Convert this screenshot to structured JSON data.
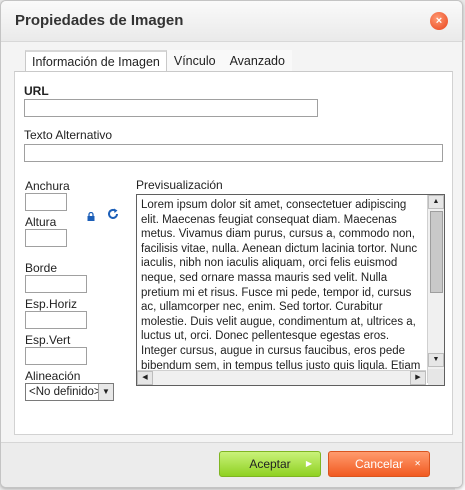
{
  "dialog": {
    "title": "Propiedades de Imagen",
    "close_glyph": "×"
  },
  "tabs": [
    {
      "label": "Información de Imagen",
      "active": true
    },
    {
      "label": "Vínculo",
      "active": false
    },
    {
      "label": "Avanzado",
      "active": false
    }
  ],
  "form": {
    "url_label": "URL",
    "url_value": "",
    "alt_label": "Texto Alternativo",
    "alt_value": "",
    "width_label": "Anchura",
    "width_value": "",
    "height_label": "Altura",
    "height_value": "",
    "border_label": "Borde",
    "border_value": "",
    "hspace_label": "Esp.Horiz",
    "hspace_value": "",
    "vspace_label": "Esp.Vert",
    "vspace_value": "",
    "align_label": "Alineación",
    "align_selected": "<No definido>"
  },
  "preview": {
    "label": "Previsualización",
    "text": "Lorem ipsum dolor sit amet, consectetuer adipiscing elit. Maecenas feugiat consequat diam. Maecenas metus. Vivamus diam purus, cursus a, commodo non, facilisis vitae, nulla. Aenean dictum lacinia tortor. Nunc iaculis, nibh non iaculis aliquam, orci felis euismod neque, sed ornare massa mauris sed velit. Nulla pretium mi et risus. Fusce mi pede, tempor id, cursus ac, ullamcorper nec, enim. Sed tortor. Curabitur molestie. Duis velit augue, condimentum at, ultrices a, luctus ut, orci. Donec pellentesque egestas eros. Integer cursus, augue in cursus faucibus, eros pede bibendum sem, in tempus tellus justo quis ligula. Etiam eget tortor."
  },
  "buttons": {
    "ok_label": "Aceptar",
    "cancel_label": "Cancelar"
  },
  "colors": {
    "ok": "#8fd122",
    "cancel": "#f15a21",
    "icon_blue": "#1c5fb8"
  }
}
